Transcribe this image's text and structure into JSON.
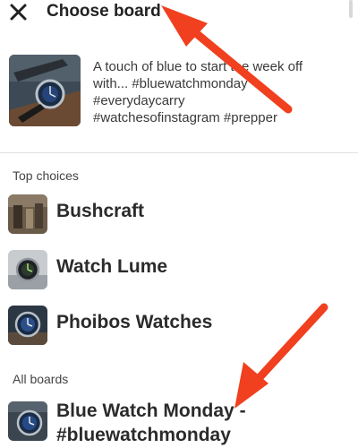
{
  "header": {
    "title": "Choose board",
    "close_icon": "close-icon"
  },
  "pin": {
    "description_lines": [
      "A touch of blue to start the week off",
      "with... #bluewatchmonday",
      "#everydaycarry",
      "#watchesofinstagram #prepper"
    ]
  },
  "top_choices": {
    "label": "Top choices",
    "boards": [
      {
        "name": "Bushcraft"
      },
      {
        "name": "Watch Lume"
      },
      {
        "name": "Phoibos Watches"
      }
    ]
  },
  "all_boards": {
    "label": "All boards",
    "boards": [
      {
        "name_lines": [
          "Blue Watch Monday -",
          "#bluewatchmonday"
        ]
      }
    ]
  },
  "colors": {
    "annotation_arrow": "#f0401f",
    "text": "#2b2b2b"
  }
}
